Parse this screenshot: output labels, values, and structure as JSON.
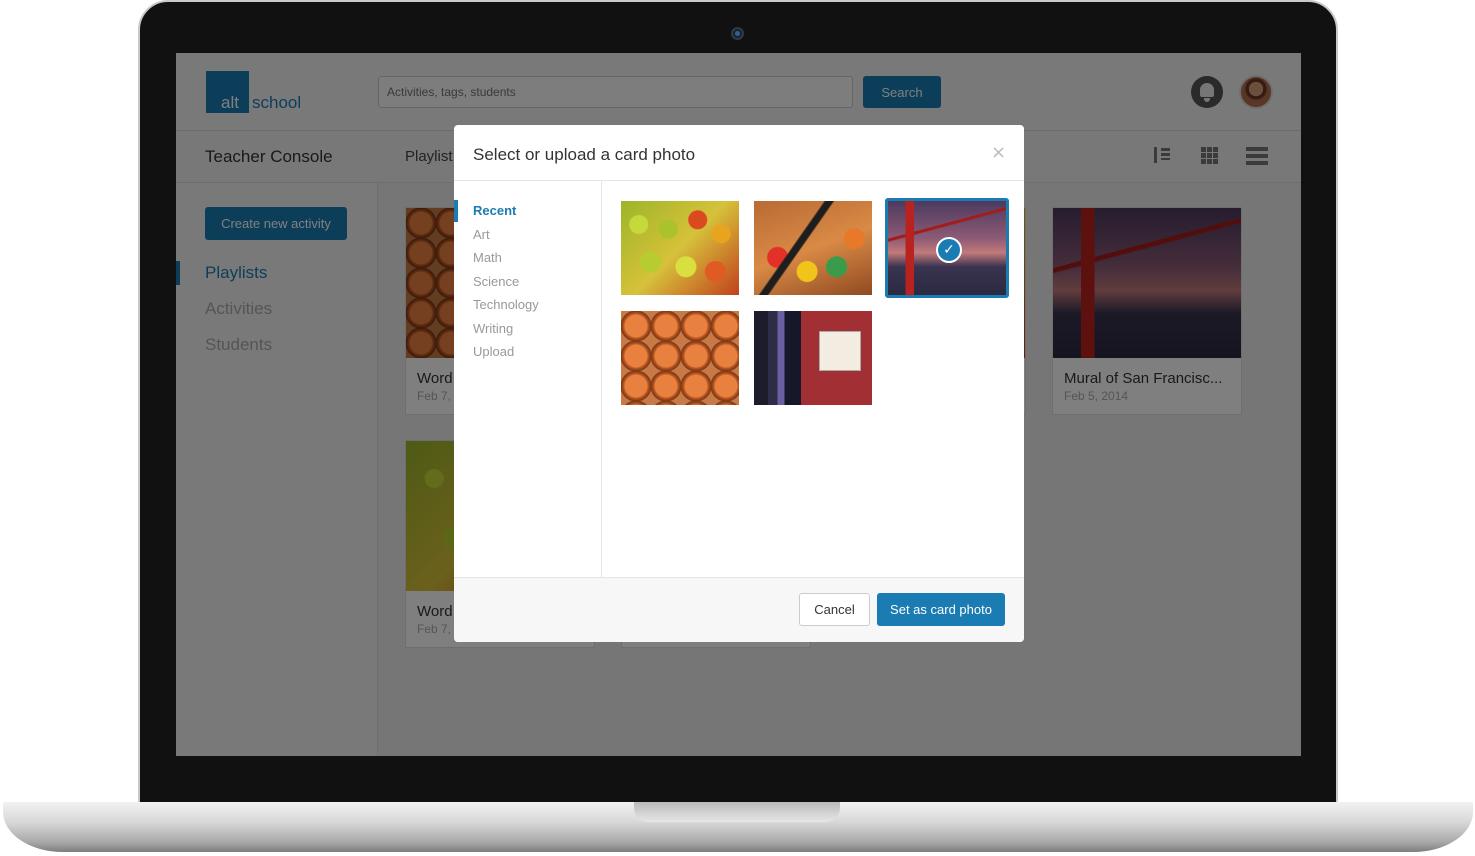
{
  "app": {
    "logo_alt": "alt",
    "logo_school": "school"
  },
  "header": {
    "search_placeholder": "Activities, tags, students",
    "search_button": "Search"
  },
  "subheader": {
    "title": "Teacher Console",
    "nav_label": "Playlist"
  },
  "sidebar": {
    "create_button": "Create new activity",
    "items": [
      {
        "label": "Playlists",
        "active": true
      },
      {
        "label": "Activities",
        "active": false
      },
      {
        "label": "Students",
        "active": false
      }
    ]
  },
  "cards": [
    {
      "title": "Word",
      "date": "Feb 7,"
    },
    {
      "title": "Word",
      "date": "Feb 7,"
    },
    {
      "title": "Mural of San Francisc...",
      "date": "Feb 5, 2014"
    }
  ],
  "modal": {
    "title": "Select or upload a card photo",
    "close_glyph": "×",
    "categories": [
      "Recent",
      "Art",
      "Math",
      "Science",
      "Technology",
      "Writing",
      "Upload"
    ],
    "active_category": "Recent",
    "photos": [
      {
        "subject": "fruit",
        "selected": false
      },
      {
        "subject": "paint",
        "selected": false
      },
      {
        "subject": "bridge",
        "selected": true
      },
      {
        "subject": "eggs",
        "selected": false
      },
      {
        "subject": "notebook",
        "selected": false
      }
    ],
    "check_glyph": "✓",
    "cancel_button": "Cancel",
    "confirm_button": "Set as card photo"
  },
  "colors": {
    "accent": "#1a7cb3"
  }
}
